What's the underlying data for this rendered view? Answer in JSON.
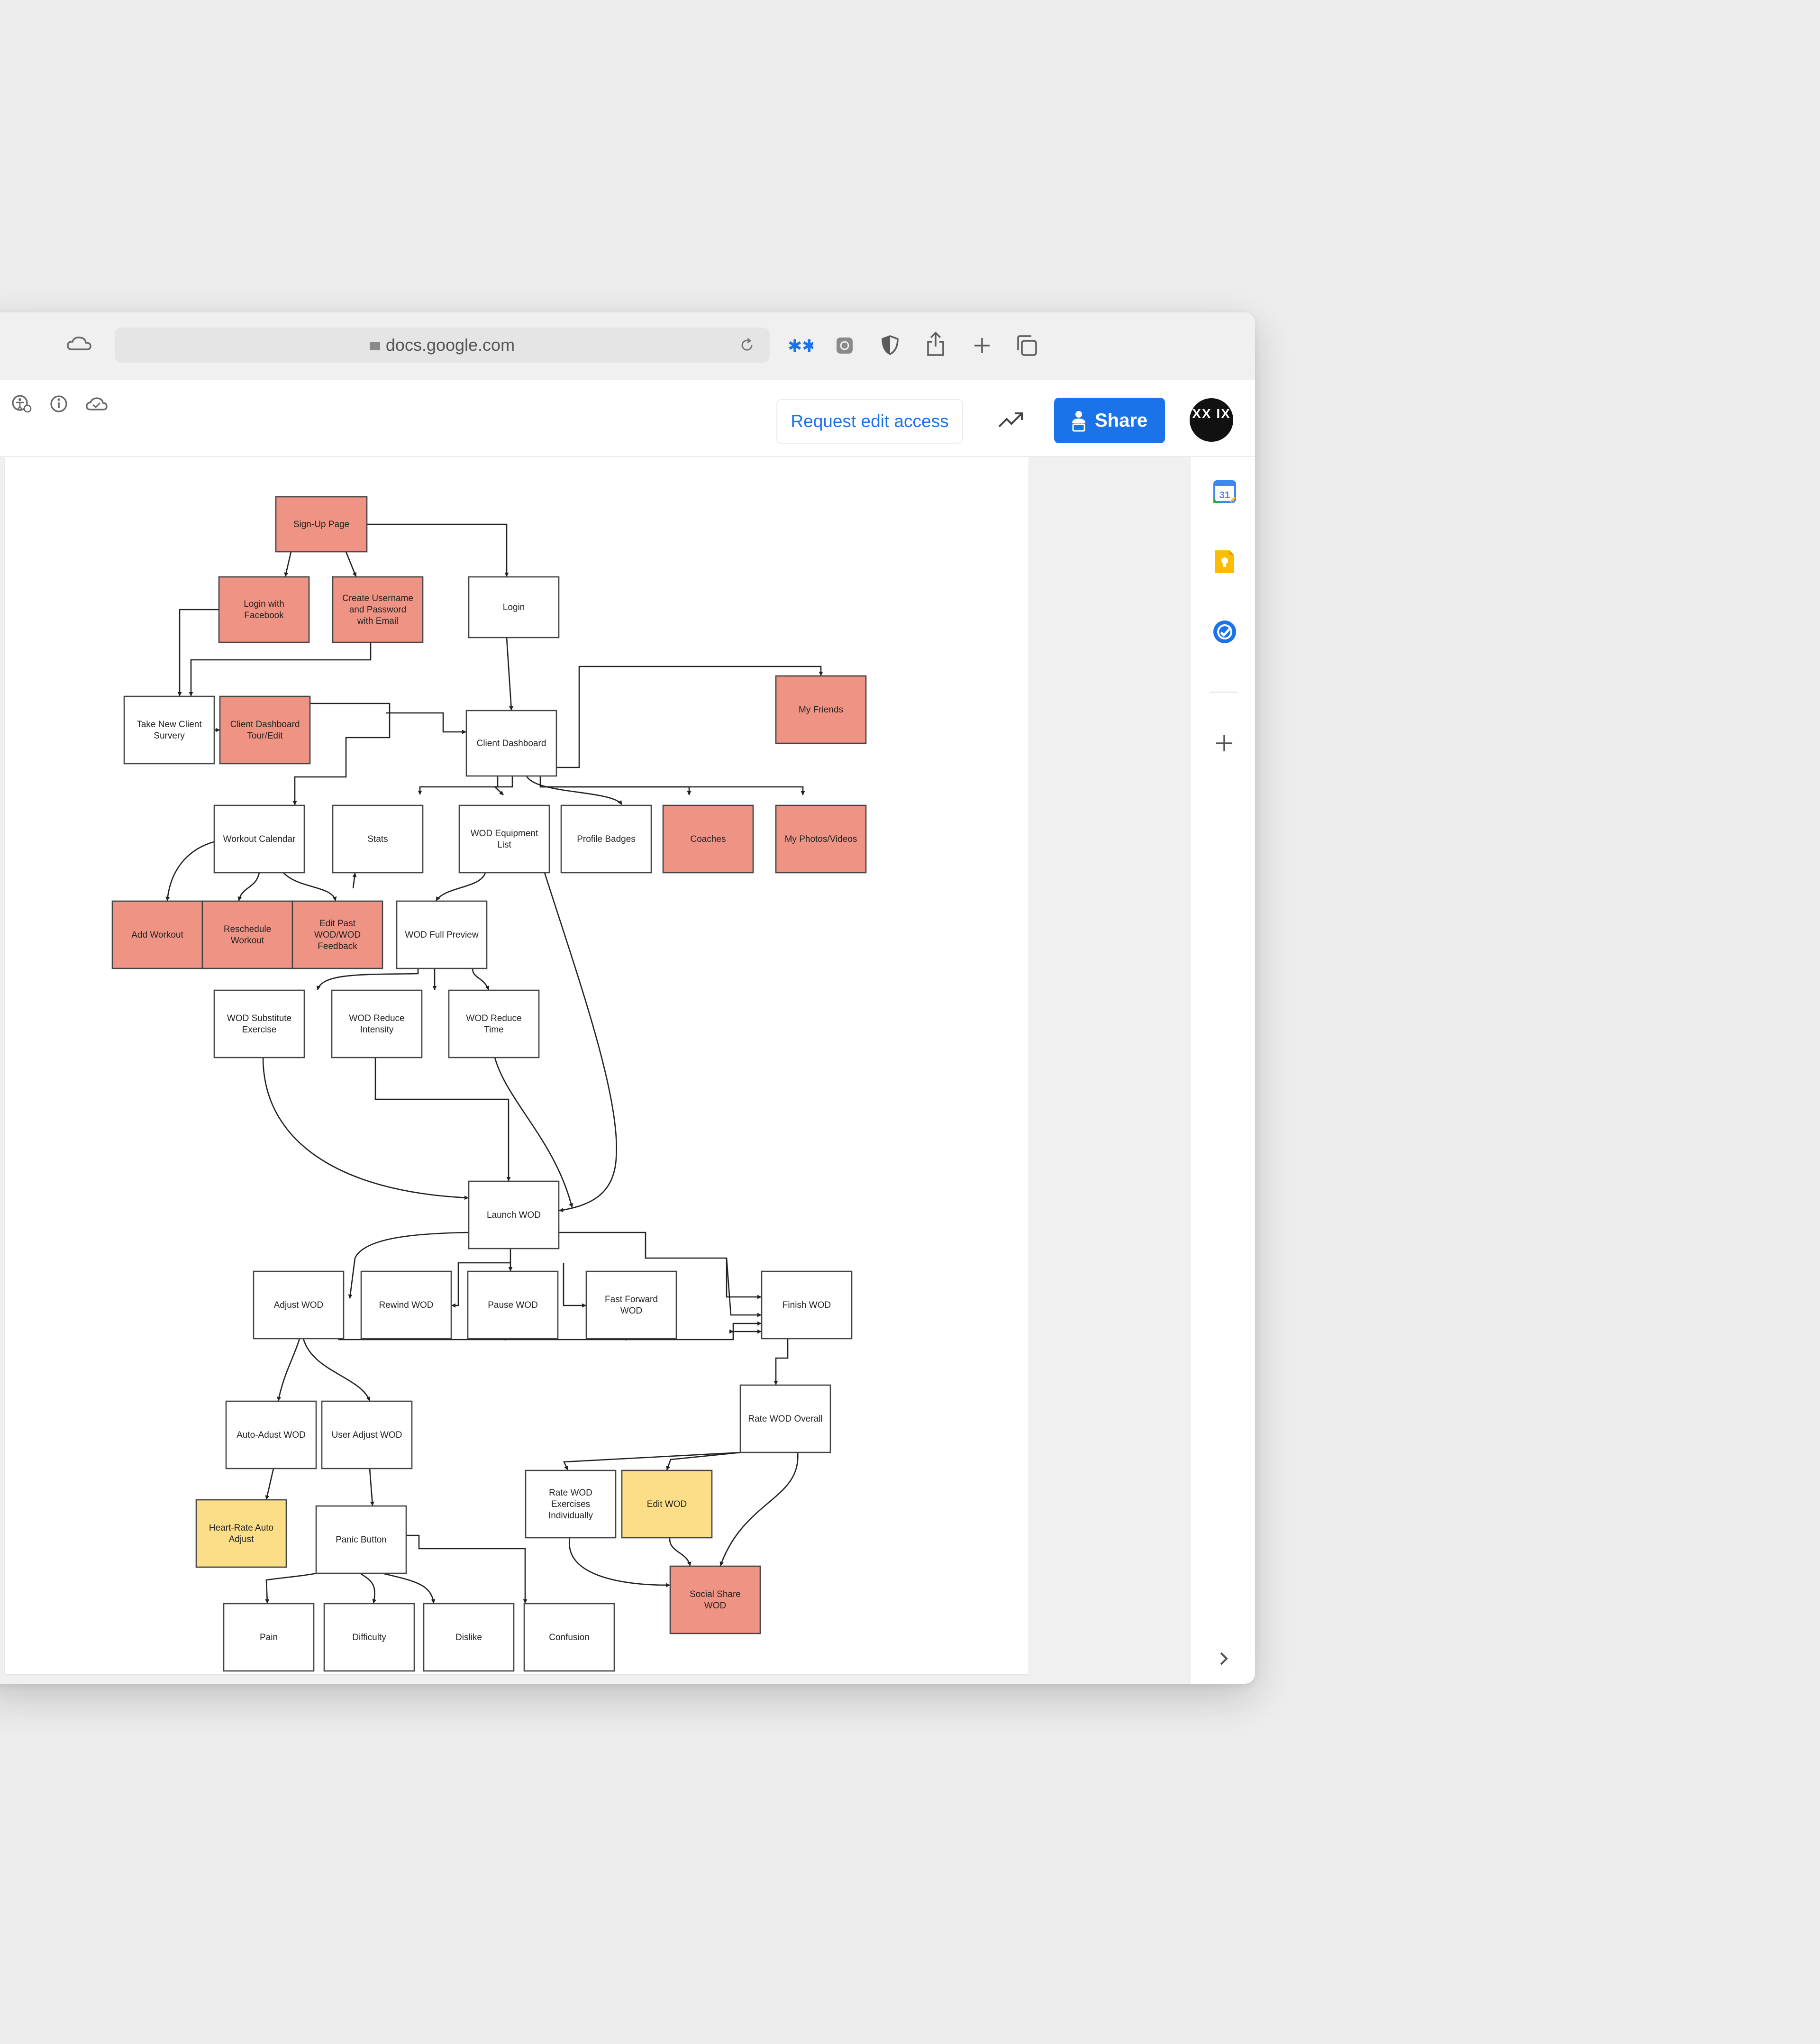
{
  "browser": {
    "url": "docs.google.com",
    "toolbar_icons": [
      "cloud-icon",
      "reload-icon",
      "extension-icon",
      "screenshot-icon",
      "privacy-icon",
      "share-icon",
      "new-tab-icon",
      "tabs-icon"
    ]
  },
  "docbar": {
    "left_icons": [
      "accessibility-icon",
      "info-icon",
      "cloud-sync-icon"
    ],
    "request_edit_label": "Request edit access",
    "activity_icon": "trending-up-icon",
    "share_label": "Share",
    "avatar_text": "XX IX"
  },
  "side_panel": {
    "icons": [
      "calendar-icon",
      "keep-icon",
      "tasks-icon",
      "add-icon",
      "chevron-right-icon"
    ],
    "calendar_day": "31"
  },
  "colors": {
    "accent": "#1a73e8",
    "node_red": "#ef9484",
    "node_yellow": "#fbde87",
    "node_white": "#ffffff"
  },
  "diagram": {
    "nodes": [
      {
        "id": "signup",
        "lines": [
          "Sign-Up Page"
        ],
        "color": "red"
      },
      {
        "id": "fb",
        "lines": [
          "Login with",
          "Facebook"
        ],
        "color": "red"
      },
      {
        "id": "create",
        "lines": [
          "Create Username",
          "and Password",
          "with Email"
        ],
        "color": "red"
      },
      {
        "id": "login",
        "lines": [
          "Login"
        ],
        "color": "white"
      },
      {
        "id": "survey",
        "lines": [
          "Take New Client",
          "Survery"
        ],
        "color": "white"
      },
      {
        "id": "tour",
        "lines": [
          "Client Dashboard",
          "Tour/Edit"
        ],
        "color": "red"
      },
      {
        "id": "dash",
        "lines": [
          "Client Dashboard"
        ],
        "color": "white"
      },
      {
        "id": "friends",
        "lines": [
          "My Friends"
        ],
        "color": "red"
      },
      {
        "id": "calendar",
        "lines": [
          "Workout Calendar"
        ],
        "color": "white"
      },
      {
        "id": "stats",
        "lines": [
          "Stats"
        ],
        "color": "white"
      },
      {
        "id": "equip",
        "lines": [
          "WOD Equipment",
          "List"
        ],
        "color": "white"
      },
      {
        "id": "badges",
        "lines": [
          "Profile Badges"
        ],
        "color": "white"
      },
      {
        "id": "coaches",
        "lines": [
          "Coaches"
        ],
        "color": "red"
      },
      {
        "id": "photos",
        "lines": [
          "My Photos/Videos"
        ],
        "color": "red"
      },
      {
        "id": "addw",
        "lines": [
          "Add Workout"
        ],
        "color": "red"
      },
      {
        "id": "resched",
        "lines": [
          "Reschedule",
          "Workout"
        ],
        "color": "red"
      },
      {
        "id": "editpast",
        "lines": [
          "Edit Past",
          "WOD/WOD",
          "Feedback"
        ],
        "color": "red"
      },
      {
        "id": "preview",
        "lines": [
          "WOD Full Preview"
        ],
        "color": "white"
      },
      {
        "id": "subst",
        "lines": [
          "WOD Substitute",
          "Exercise"
        ],
        "color": "white"
      },
      {
        "id": "redint",
        "lines": [
          "WOD Reduce",
          "Intensity"
        ],
        "color": "white"
      },
      {
        "id": "redtime",
        "lines": [
          "WOD Reduce",
          "Time"
        ],
        "color": "white"
      },
      {
        "id": "launch",
        "lines": [
          "Launch WOD"
        ],
        "color": "white"
      },
      {
        "id": "adjust",
        "lines": [
          "Adjust WOD"
        ],
        "color": "white"
      },
      {
        "id": "rewind",
        "lines": [
          "Rewind WOD"
        ],
        "color": "white"
      },
      {
        "id": "pause",
        "lines": [
          "Pause WOD"
        ],
        "color": "white"
      },
      {
        "id": "ff",
        "lines": [
          "Fast Forward",
          "WOD"
        ],
        "color": "white"
      },
      {
        "id": "finish",
        "lines": [
          "Finish WOD"
        ],
        "color": "white"
      },
      {
        "id": "autoadj",
        "lines": [
          "Auto-Adust WOD"
        ],
        "color": "white"
      },
      {
        "id": "useradj",
        "lines": [
          "User Adjust WOD"
        ],
        "color": "white"
      },
      {
        "id": "rateov",
        "lines": [
          "Rate WOD Overall"
        ],
        "color": "white"
      },
      {
        "id": "ratex",
        "lines": [
          "Rate WOD",
          "Exercises",
          "Individually"
        ],
        "color": "white"
      },
      {
        "id": "editwod",
        "lines": [
          "Edit WOD"
        ],
        "color": "yellow"
      },
      {
        "id": "hr",
        "lines": [
          "Heart-Rate Auto",
          "Adjust"
        ],
        "color": "yellow"
      },
      {
        "id": "panic",
        "lines": [
          "Panic Button"
        ],
        "color": "white"
      },
      {
        "id": "social",
        "lines": [
          "Social Share",
          "WOD"
        ],
        "color": "red"
      },
      {
        "id": "pain",
        "lines": [
          "Pain"
        ],
        "color": "white"
      },
      {
        "id": "diff",
        "lines": [
          "Difficulty"
        ],
        "color": "white"
      },
      {
        "id": "dislike",
        "lines": [
          "Dislike"
        ],
        "color": "white"
      },
      {
        "id": "confusion",
        "lines": [
          "Confusion"
        ],
        "color": "white"
      }
    ]
  }
}
